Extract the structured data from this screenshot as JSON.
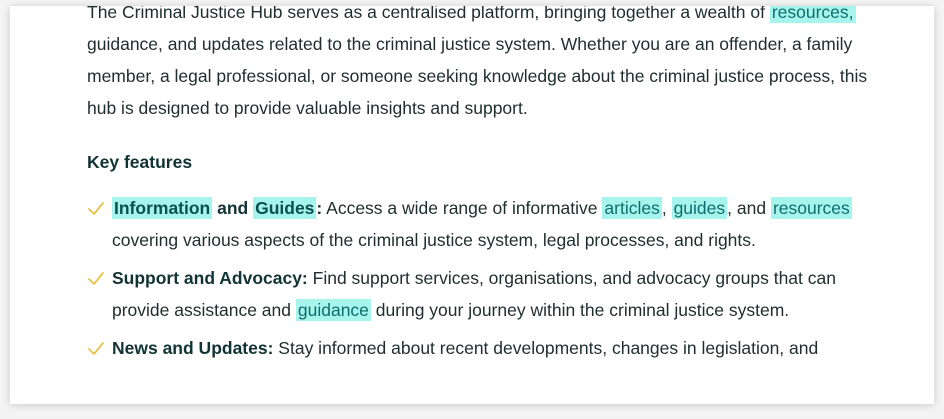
{
  "intro": {
    "part1": "The Criminal Justice Hub serves as a centralised platform, bringing together a wealth of ",
    "link_resources": "resources,",
    "part2": " guidance, and updates related to the criminal justice system. Whether you are an offender, a family member, a legal professional, or someone seeking knowledge about the criminal justice process, this hub is designed to provide valuable insights and support."
  },
  "key_features": {
    "title": "Key features",
    "items": [
      {
        "title_a": "Information",
        "title_and": " and ",
        "title_b": "Guides",
        "colon": ":",
        "text1": " Access a wide range of informative ",
        "link1": "articles",
        "sep1": ", ",
        "link2": "guides",
        "sep2": ", and ",
        "link3": "resources",
        "text2": " covering various aspects of the criminal justice system, legal processes, and rights."
      },
      {
        "title": "Support and Advocacy:",
        "text1": " Find support services, organisations, and advocacy groups that can provide assistance and ",
        "link1": "guidance",
        "text2": " during your journey within the criminal justice system."
      },
      {
        "title": "News and Updates:",
        "text1": " Stay informed about recent developments, changes in legislation, and"
      }
    ]
  },
  "colors": {
    "highlight": "#a6f4ec",
    "check": "#e6c24a",
    "text": "#1f2d2d"
  }
}
